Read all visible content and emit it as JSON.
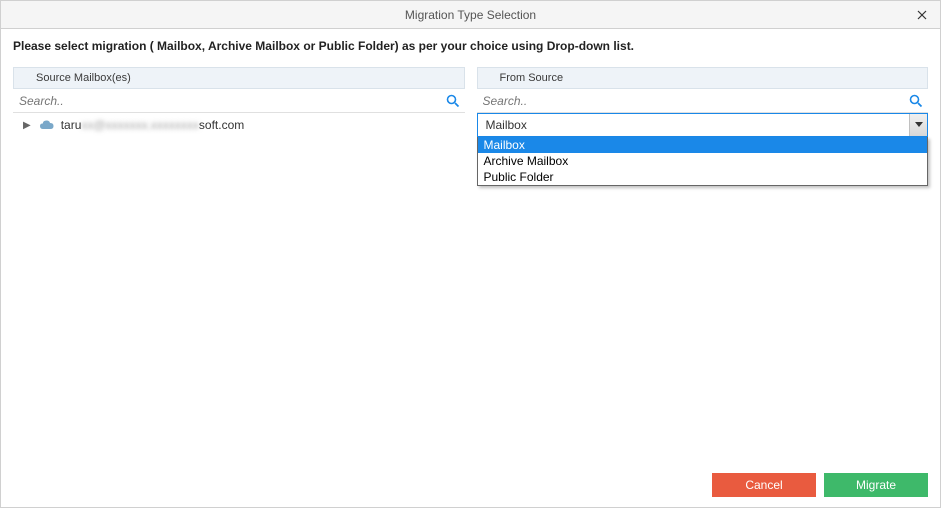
{
  "window": {
    "title": "Migration Type Selection"
  },
  "instruction": "Please select migration ( Mailbox, Archive Mailbox or Public Folder) as per your choice using Drop-down list.",
  "left": {
    "header": "Source Mailbox(es)",
    "search_placeholder": "Search..",
    "mailbox_prefix": "taru",
    "mailbox_suffix": "soft.com"
  },
  "right": {
    "header": "From Source",
    "search_placeholder": "Search..",
    "selected": "Mailbox",
    "options": [
      "Mailbox",
      "Archive Mailbox",
      "Public Folder"
    ]
  },
  "footer": {
    "cancel_label": "Cancel",
    "migrate_label": "Migrate"
  },
  "colors": {
    "accent": "#1a88e8",
    "cancel": "#e95b3f",
    "migrate": "#3eb96a"
  }
}
